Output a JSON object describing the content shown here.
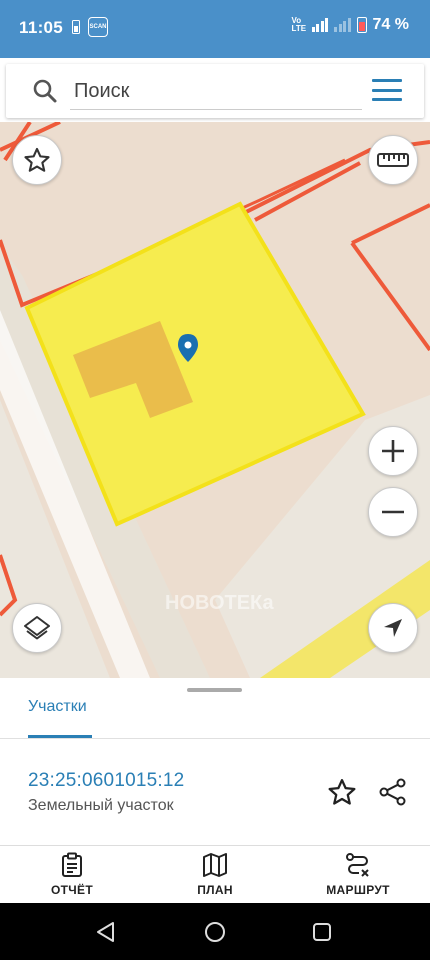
{
  "status_bar": {
    "time": "11:05",
    "scan_label": "SCAN",
    "battery_percent": "74 %"
  },
  "search": {
    "placeholder": "Поиск"
  },
  "map": {
    "watermark": "НОВОТЕКа"
  },
  "sheet": {
    "tab_label": "Участки",
    "cadastral_number": "23:25:0601015:12",
    "parcel_type": "Земельный участок"
  },
  "bottom_nav": {
    "report": "ОТЧЁТ",
    "plan": "ПЛАН",
    "route": "МАРШРУТ"
  },
  "colors": {
    "accent": "#2a7fb5",
    "status_bar": "#4a90c9",
    "parcel_fill": "#f6ec4f",
    "parcel_border": "#f3e11a",
    "boundary_red": "#ee5a3a"
  }
}
